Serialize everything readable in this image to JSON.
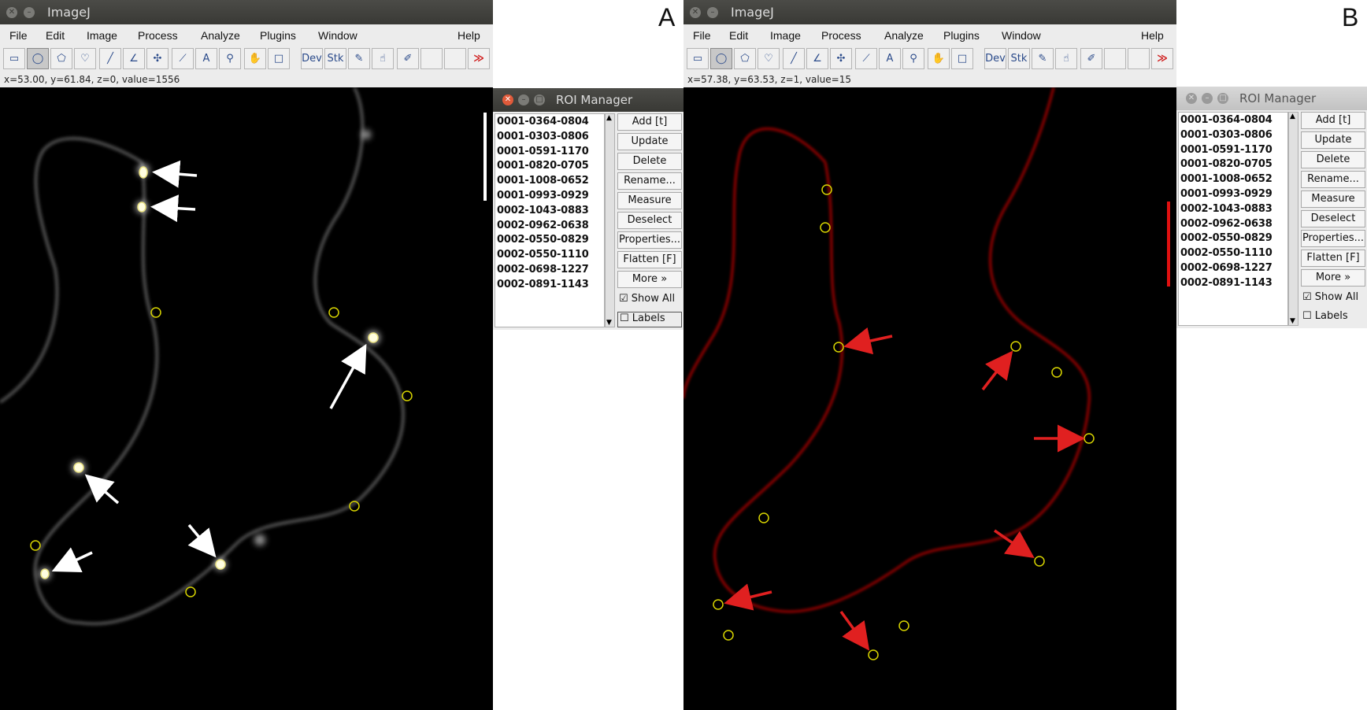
{
  "panels": [
    {
      "letter": "A",
      "window_title": "ImageJ",
      "status_text": "x=53.00, y=61.84, z=0, value=1556",
      "roi_title": "ROI Manager",
      "arrow_color": "#ffffff",
      "filament_color": "#c8c8c8"
    },
    {
      "letter": "B",
      "window_title": "ImageJ",
      "status_text": "x=57.38, y=63.53, z=1, value=15",
      "roi_title": "ROI Manager",
      "arrow_color": "#e02020",
      "filament_color": "#9a0000"
    }
  ],
  "menus": [
    "File",
    "Edit",
    "Image",
    "Process",
    "Analyze",
    "Plugins",
    "Window",
    "Help"
  ],
  "tools": {
    "dev_label": "Dev",
    "stk_label": "Stk",
    "text_tool": "A",
    "more_tools": "≫"
  },
  "roi_items": [
    "0001-0364-0804",
    "0001-0303-0806",
    "0001-0591-1170",
    "0001-0820-0705",
    "0001-1008-0652",
    "0001-0993-0929",
    "0002-1043-0883",
    "0002-0962-0638",
    "0002-0550-0829",
    "0002-0550-1110",
    "0002-0698-1227",
    "0002-0891-1143"
  ],
  "roi_buttons": [
    "Add [t]",
    "Update",
    "Delete",
    "Rename...",
    "Measure",
    "Deselect",
    "Properties...",
    "Flatten [F]",
    "More »"
  ],
  "roi_checks": {
    "show_all": "Show All",
    "labels": "Labels"
  },
  "colors": {
    "roi_circle": "#d8d400",
    "scalebar_a": "#ffffff",
    "scalebar_b": "#e01010"
  }
}
